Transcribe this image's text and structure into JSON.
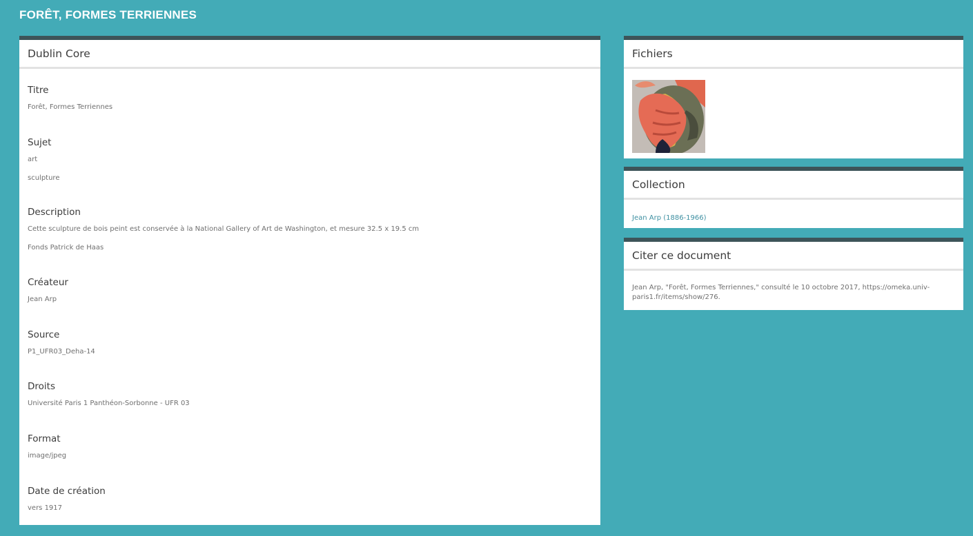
{
  "page_title": "FORÊT, FORMES TERRIENNES",
  "dublin_core": {
    "heading": "Dublin Core",
    "fields": [
      {
        "label": "Titre",
        "values": [
          "Forêt, Formes Terriennes"
        ]
      },
      {
        "label": "Sujet",
        "values": [
          "art",
          "sculpture"
        ]
      },
      {
        "label": "Description",
        "values": [
          "Cette sculpture de bois peint est conservée à la National Gallery of Art de Washington, et mesure 32.5 x 19.5 cm",
          "Fonds Patrick de Haas"
        ]
      },
      {
        "label": "Créateur",
        "values": [
          "Jean Arp"
        ]
      },
      {
        "label": "Source",
        "values": [
          "P1_UFR03_Deha-14"
        ]
      },
      {
        "label": "Droits",
        "values": [
          "Université Paris 1 Panthéon-Sorbonne - UFR 03"
        ]
      },
      {
        "label": "Format",
        "values": [
          "image/jpeg"
        ]
      },
      {
        "label": "Date de création",
        "values": [
          "vers 1917"
        ]
      }
    ]
  },
  "files": {
    "heading": "Fichiers"
  },
  "collection": {
    "heading": "Collection",
    "link": "Jean Arp (1886-1966)"
  },
  "cite": {
    "heading": "Citer ce document",
    "text": "Jean Arp, \"Forêt, Formes Terriennes,\" consulté le 10 octobre 2017, https://omeka.univ-paris1.fr/items/show/276."
  },
  "colors": {
    "background": "#43abb7",
    "panel_top_border": "#3d5459",
    "link": "#3d8fa1"
  }
}
